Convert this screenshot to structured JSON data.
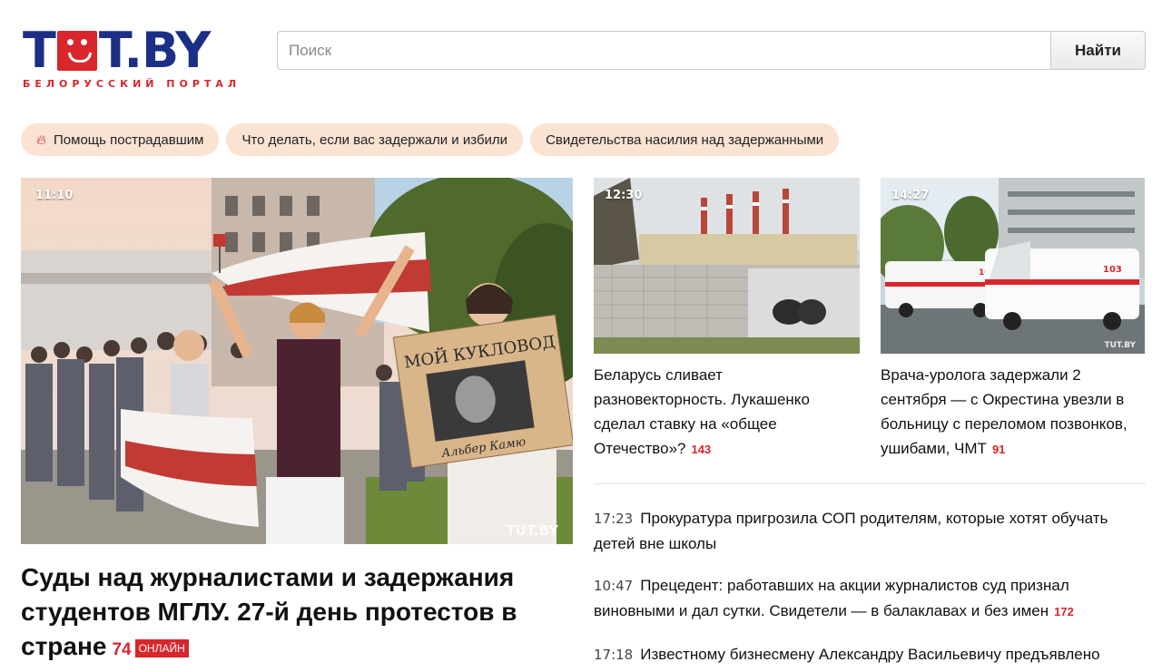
{
  "header": {
    "logo_text_left": "T",
    "logo_text_right": "T.BY",
    "logo_subtitle": "БЕЛОРУССКИЙ ПОРТАЛ",
    "search_placeholder": "Поиск",
    "search_button": "Найти"
  },
  "pills": [
    {
      "label": "Помощь пострадавшим",
      "icon": "flame-icon"
    },
    {
      "label": "Что делать, если вас задержали и избили"
    },
    {
      "label": "Свидетельства насилия над задержанными"
    }
  ],
  "main_article": {
    "time": "11:10",
    "title": "Суды над журналистами и задержания студентов МГЛУ. 27-й день протестов в стране",
    "comments": "74",
    "badge": "ОНЛАЙН",
    "watermark": "TUT.BY",
    "sign_text": "МОЙ КУКЛОВОД",
    "sign_caption": "Альбер Камю"
  },
  "cards": [
    {
      "time": "12:30",
      "title": "Беларусь сливает разновекторность. Лукашенко сделал ставку на «общее Отечество»?",
      "comments": "143"
    },
    {
      "time": "14:27",
      "title": "Врача-уролога задержали 2 сентября — с Окрестина увезли в больницу с переломом позвонков, ушибами, ЧМТ",
      "comments": "91",
      "ambulance_number": "103",
      "watermark": "TUT.BY"
    }
  ],
  "news": [
    {
      "time": "17:23",
      "title": "Прокуратура пригрозила СОП родителям, которые хотят обучать детей вне школы",
      "comments": ""
    },
    {
      "time": "10:47",
      "title": "Прецедент: работавших на акции журналистов суд признал виновными и дал сутки. Свидетели — в балаклавах и без имен",
      "comments": "172"
    },
    {
      "time": "17:18",
      "title": "Известному бизнесмену Александру Васильевичу предъявлено",
      "comments": ""
    }
  ],
  "colors": {
    "brand_blue": "#1b2f86",
    "brand_red": "#d8262c",
    "pill_bg": "#fbe3d3"
  }
}
